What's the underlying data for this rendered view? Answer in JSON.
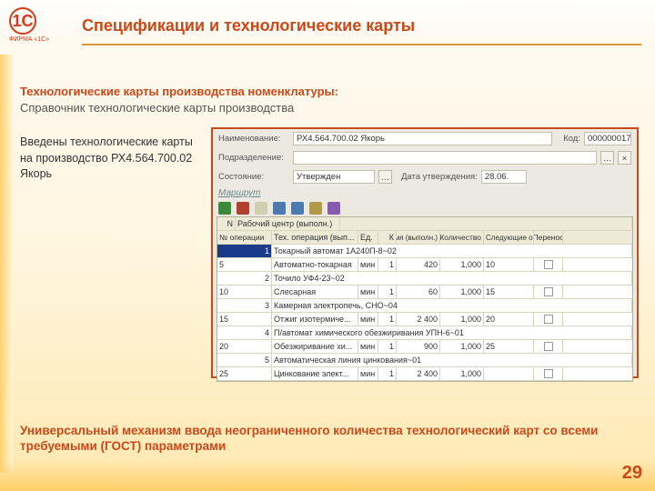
{
  "logo": {
    "symbol": "1С",
    "caption": "ФИРМА «1С»"
  },
  "title": "Спецификации и технологические карты",
  "subtitle_red": "Технологические карты производства номенклатуры:",
  "subtitle_gray": "Справочник технологические карты производства",
  "sidenote": "Введены технологические карты на производство РХ4.564.700.02 Якорь",
  "form": {
    "name_label": "Наименование:",
    "name_value": "РХ4.564.700.02 Якорь",
    "code_label": "Код:",
    "code_value": "000000017",
    "dept_label": "Подразделение:",
    "dept_value": "",
    "state_label": "Состояние:",
    "state_value": "Утвержден",
    "date_label": "Дата утверждения:",
    "date_value": "28.06.",
    "marshrut": "Маршрут"
  },
  "columns": {
    "n": "N",
    "n2": "№ операции",
    "rc": "Рабочий центр (выполн.)",
    "op": "Тех. операция (вып...",
    "ed": "Ед.",
    "k": "К",
    "vr": "Время (выполн.)",
    "kol": "Количество",
    "sl": "Следующие опе...",
    "pe": "Перенос"
  },
  "rows": [
    {
      "n": "1",
      "n2": "5",
      "group": "Токарный автомат 1А240П-8~02",
      "op": "Автоматно-токарная",
      "ed": "мин",
      "k": "1",
      "vr": "420",
      "kol": "1,000",
      "sl": "10"
    },
    {
      "n": "2",
      "n2": "10",
      "group": "Точило УФ4-23~02",
      "op": "Слесарная",
      "ed": "мин",
      "k": "1",
      "vr": "60",
      "kol": "1,000",
      "sl": "15"
    },
    {
      "n": "3",
      "n2": "15",
      "group": "Камерная электропечь, СНО~04",
      "op": "Отжиг изотермиче...",
      "ed": "мин",
      "k": "1",
      "vr": "2 400",
      "kol": "1,000",
      "sl": "20"
    },
    {
      "n": "4",
      "n2": "20",
      "group": "П/автомат химического обезжиривания УПН-6~01",
      "op": "Обезжиривание хи...",
      "ed": "мин",
      "k": "1",
      "vr": "900",
      "kol": "1,000",
      "sl": "25"
    },
    {
      "n": "5",
      "n2": "25",
      "group": "Автоматическая линия цинкования~01",
      "op": "Цинкование элект...",
      "ed": "мин",
      "k": "1",
      "vr": "2 400",
      "kol": "1,000",
      "sl": ""
    }
  ],
  "footer": "Универсальный механизм ввода неограниченного количества технологический карт со всеми требуемыми (ГОСТ) параметрами",
  "page": "29"
}
